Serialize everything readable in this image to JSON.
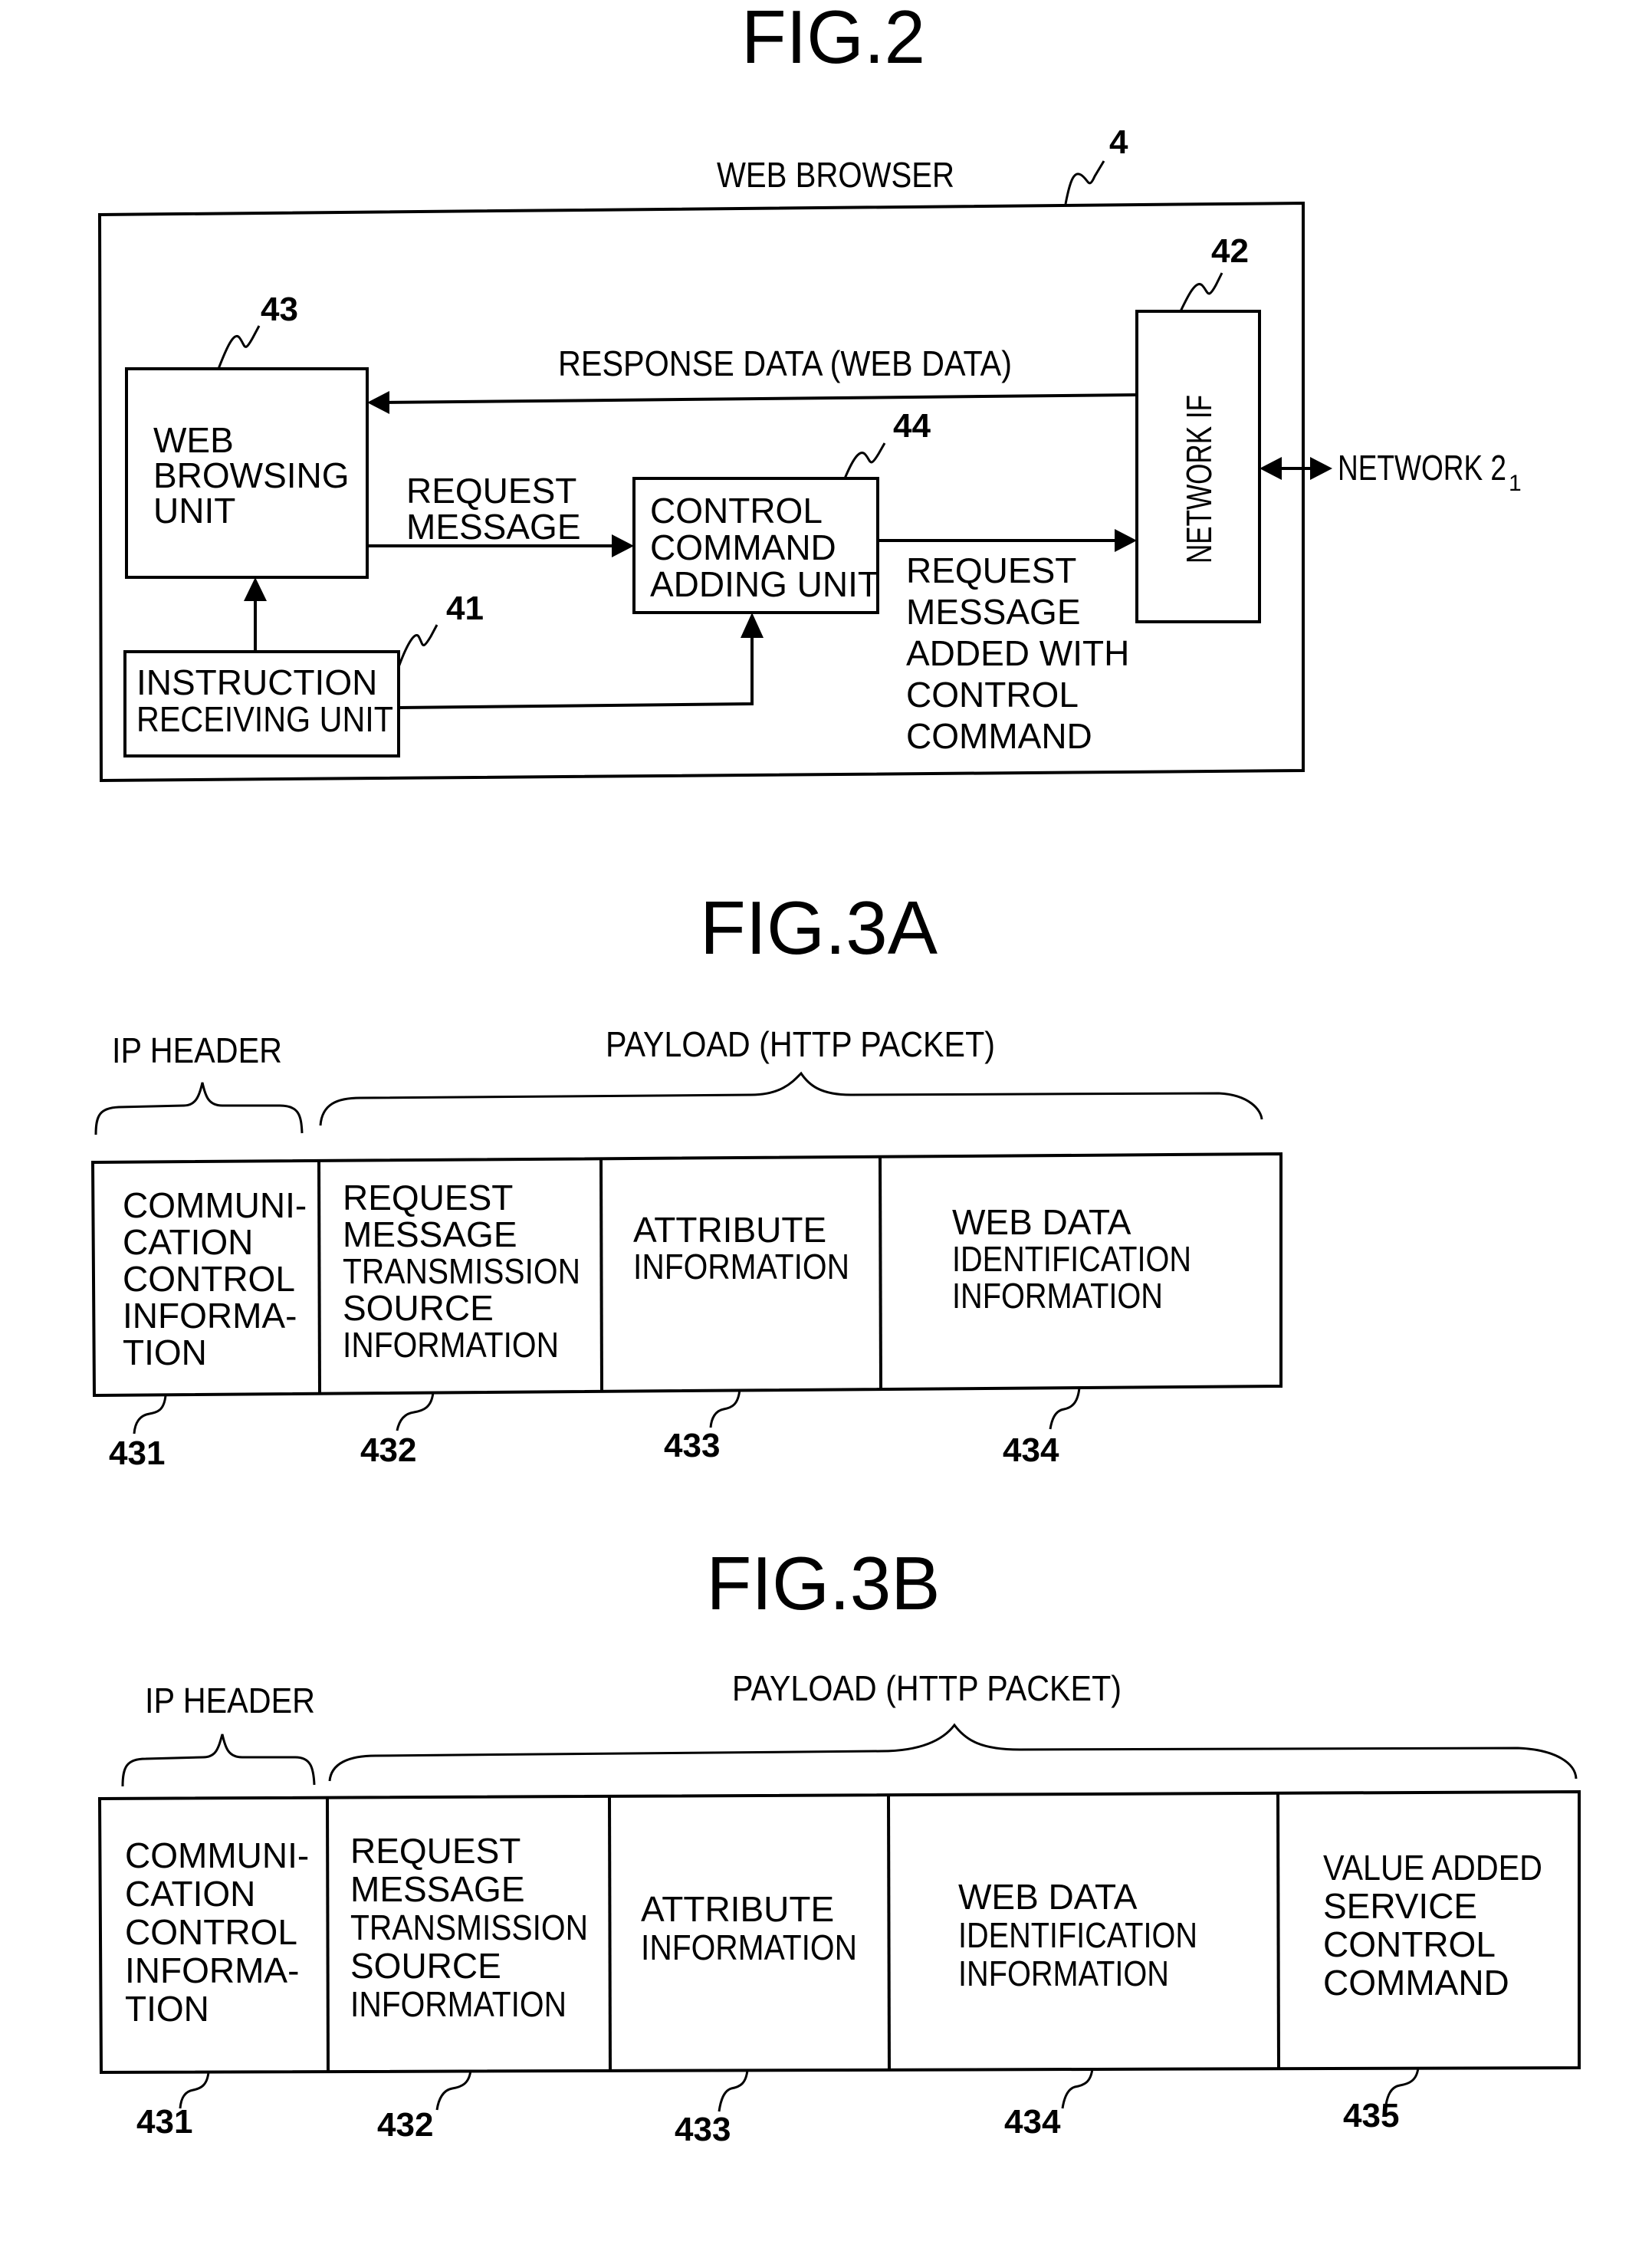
{
  "fig2": {
    "title": "FIG.2",
    "container": {
      "label": "WEB BROWSER",
      "ref": "4"
    },
    "blocks": {
      "web_browsing_unit": {
        "lines": [
          "WEB",
          "BROWSING",
          "UNIT"
        ],
        "ref": "43"
      },
      "network_if": {
        "label": "NETWORK IF",
        "ref": "42"
      },
      "control_command_adding_unit": {
        "lines": [
          "CONTROL",
          "COMMAND",
          "ADDING UNIT"
        ],
        "ref": "44"
      },
      "instruction_receiving_unit": {
        "lines": [
          "INSTRUCTION",
          "RECEIVING UNIT"
        ],
        "ref": "41"
      }
    },
    "flows": {
      "response_data": "RESPONSE DATA (WEB DATA)",
      "request_message": [
        "REQUEST",
        "MESSAGE"
      ],
      "request_message_with_command": [
        "REQUEST",
        "MESSAGE",
        "ADDED WITH",
        "CONTROL",
        "COMMAND"
      ],
      "network": {
        "label": "NETWORK 2",
        "subscript": "1"
      }
    }
  },
  "fig3a": {
    "title": "FIG.3A",
    "header_label": "IP HEADER",
    "payload_label": "PAYLOAD (HTTP PACKET)",
    "cells": [
      {
        "lines": [
          "COMMUNI-",
          "CATION",
          "CONTROL",
          "INFORMA-",
          "TION"
        ],
        "ref": "431"
      },
      {
        "lines": [
          "REQUEST",
          "MESSAGE",
          "TRANSMISSION",
          "SOURCE",
          "INFORMATION"
        ],
        "ref": "432"
      },
      {
        "lines": [
          "ATTRIBUTE",
          "INFORMATION"
        ],
        "ref": "433"
      },
      {
        "lines": [
          "WEB DATA",
          "IDENTIFICATION",
          "INFORMATION"
        ],
        "ref": "434"
      }
    ]
  },
  "fig3b": {
    "title": "FIG.3B",
    "header_label": "IP HEADER",
    "payload_label": "PAYLOAD (HTTP PACKET)",
    "cells": [
      {
        "lines": [
          "COMMUNI-",
          "CATION",
          "CONTROL",
          "INFORMA-",
          "TION"
        ],
        "ref": "431"
      },
      {
        "lines": [
          "REQUEST",
          "MESSAGE",
          "TRANSMISSION",
          "SOURCE",
          "INFORMATION"
        ],
        "ref": "432"
      },
      {
        "lines": [
          "ATTRIBUTE",
          "INFORMATION"
        ],
        "ref": "433"
      },
      {
        "lines": [
          "WEB DATA",
          "IDENTIFICATION",
          "INFORMATION"
        ],
        "ref": "434"
      },
      {
        "lines": [
          "VALUE ADDED",
          "SERVICE",
          "CONTROL",
          "COMMAND"
        ],
        "ref": "435"
      }
    ]
  }
}
